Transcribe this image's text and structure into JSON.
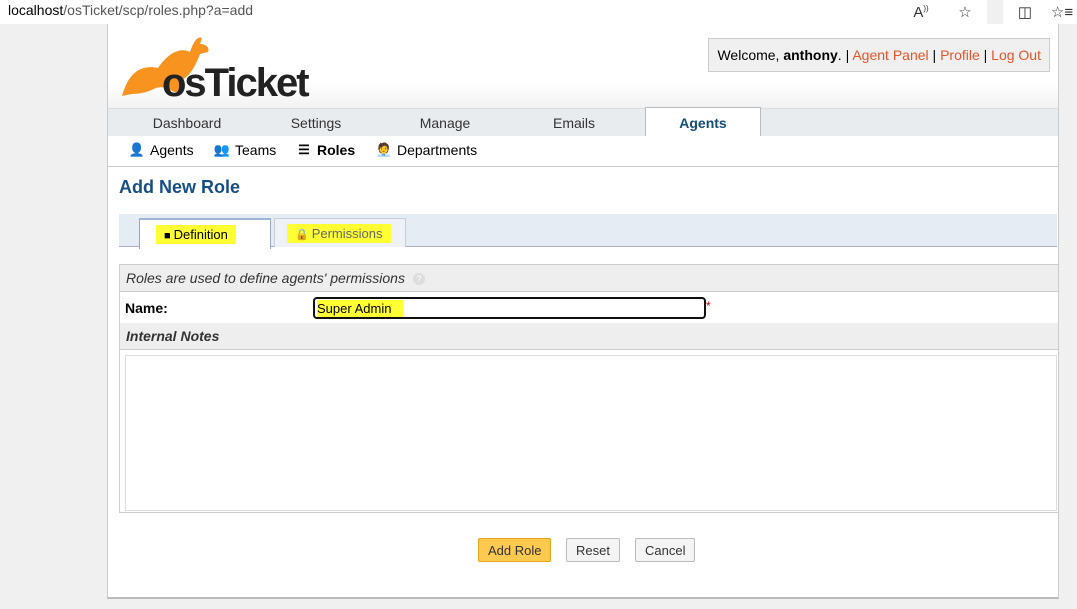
{
  "browser": {
    "url_host": "localhost",
    "url_path": "/osTicket/scp/roles.php?a=add"
  },
  "header": {
    "logo_text": "osTicket",
    "welcome_prefix": "Welcome, ",
    "username": "anthony",
    "sep1": ". | ",
    "agent_panel": "Agent Panel",
    "sep2": " | ",
    "profile": "Profile",
    "sep3": " | ",
    "logout": "Log Out"
  },
  "nav": {
    "items": [
      {
        "label": "Dashboard"
      },
      {
        "label": "Settings"
      },
      {
        "label": "Manage"
      },
      {
        "label": "Emails"
      },
      {
        "label": "Agents"
      }
    ]
  },
  "subnav": {
    "items": [
      {
        "label": "Agents",
        "icon": "agent-icon"
      },
      {
        "label": "Teams",
        "icon": "teams-icon"
      },
      {
        "label": "Roles",
        "icon": "roles-icon"
      },
      {
        "label": "Departments",
        "icon": "departments-icon"
      }
    ]
  },
  "main": {
    "title": "Add New Role",
    "tabs": [
      {
        "label": "Definition",
        "icon": "document-icon"
      },
      {
        "label": "Permissions",
        "icon": "lock-icon"
      }
    ],
    "roles_intro": "Roles are used to define agents' permissions",
    "name_label": "Name:",
    "name_value": "Super Admin",
    "required_mark": "*",
    "notes_label": "Internal Notes",
    "notes_value": ""
  },
  "buttons": {
    "add": "Add Role",
    "reset": "Reset",
    "cancel": "Cancel"
  },
  "colors": {
    "accent": "#E6552A",
    "title": "#174f85",
    "highlight": "#ffff33",
    "primary_button": "#fdc94f"
  }
}
